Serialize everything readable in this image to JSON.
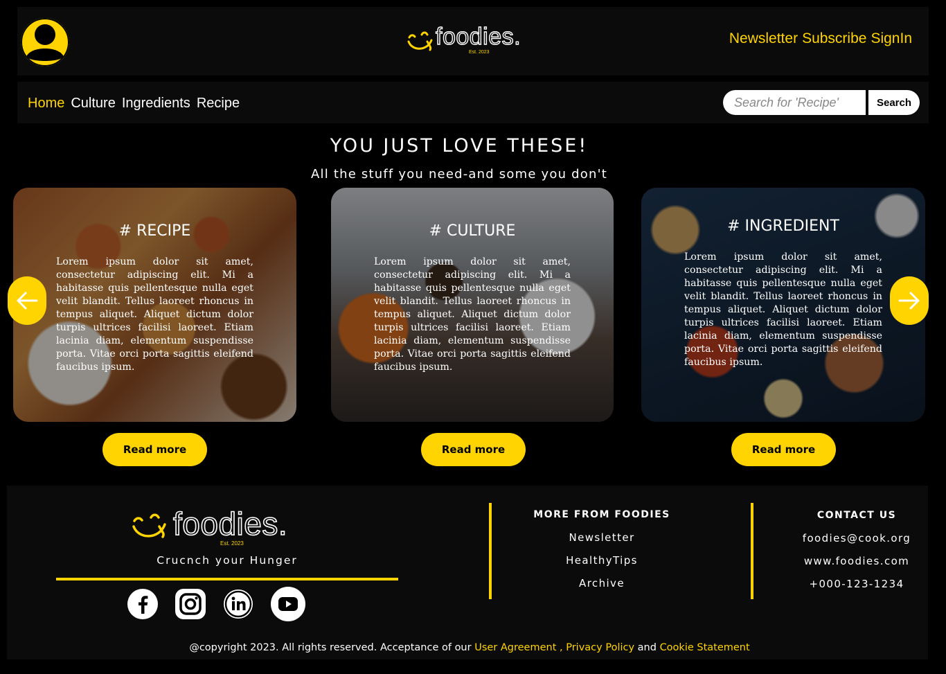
{
  "header": {
    "logo_text": "foodies.",
    "logo_est": "Est. 2023",
    "nav": [
      "Newsletter",
      "Subscribe",
      "SignIn"
    ]
  },
  "navbar": {
    "home": "Home",
    "links": [
      "Culture",
      "Ingredients",
      "Recipe"
    ],
    "search_placeholder": "Search for 'Recipe'",
    "search_button": "Search"
  },
  "hero": {
    "title": "YOU JUST LOVE THESE!",
    "subtitle": "All the stuff you need-and some you don't"
  },
  "cards": [
    {
      "title": "# RECIPE",
      "text": "Lorem ipsum dolor sit amet, consectetur adipiscing elit. Mi a habitasse quis pellentesque nulla eget velit blandit. Tellus laoreet rhoncus in tempus aliquet. Aliquet dictum dolor turpis ultrices facilisi laoreet. Etiam lacinia diam, elementum suspendisse porta. Vitae orci porta sagittis eleifend faucibus ipsum.",
      "button": "Read more"
    },
    {
      "title": "# CULTURE",
      "text": "Lorem ipsum dolor sit amet, consectetur adipiscing elit. Mi a habitasse quis pellentesque nulla eget velit blandit. Tellus laoreet rhoncus in tempus aliquet. Aliquet dictum dolor turpis ultrices facilisi laoreet. Etiam lacinia diam, elementum suspendisse porta. Vitae orci porta sagittis eleifend faucibus ipsum.",
      "button": "Read more"
    },
    {
      "title": "# INGREDIENT",
      "text": "Lorem ipsum dolor sit amet, consectetur adipiscing elit. Mi a habitasse quis pellentesque nulla eget velit blandit. Tellus laoreet rhoncus in tempus aliquet. Aliquet dictum dolor turpis ultrices facilisi laoreet. Etiam lacinia diam, elementum suspendisse porta. Vitae orci porta sagittis eleifend faucibus ipsum.",
      "button": "Read more"
    }
  ],
  "footer": {
    "logo_text": "foodies.",
    "logo_est": "Est. 2023",
    "tagline": "Crucnch your Hunger",
    "socials": [
      "facebook-icon",
      "instagram-icon",
      "linkedin-icon",
      "youtube-icon"
    ],
    "more_title": "MORE FROM FOODIES",
    "more_links": [
      "Newsletter",
      "HealthyTips",
      "Archive"
    ],
    "contact_title": "CONTACT US",
    "contact_lines": [
      "foodies@cook.org",
      "www.foodies.com",
      "+000-123-1234"
    ],
    "copyright_prefix": "@copyright 2023. All rights reserved. Acceptance of our ",
    "user_agreement": "User Agreement",
    "comma": " , ",
    "privacy_policy": "Privacy Policy",
    "and": " and ",
    "cookie_statement": "Cookie Statement"
  },
  "colors": {
    "accent": "#ffd400",
    "background": "#000000",
    "panel": "#0b0b0b"
  }
}
